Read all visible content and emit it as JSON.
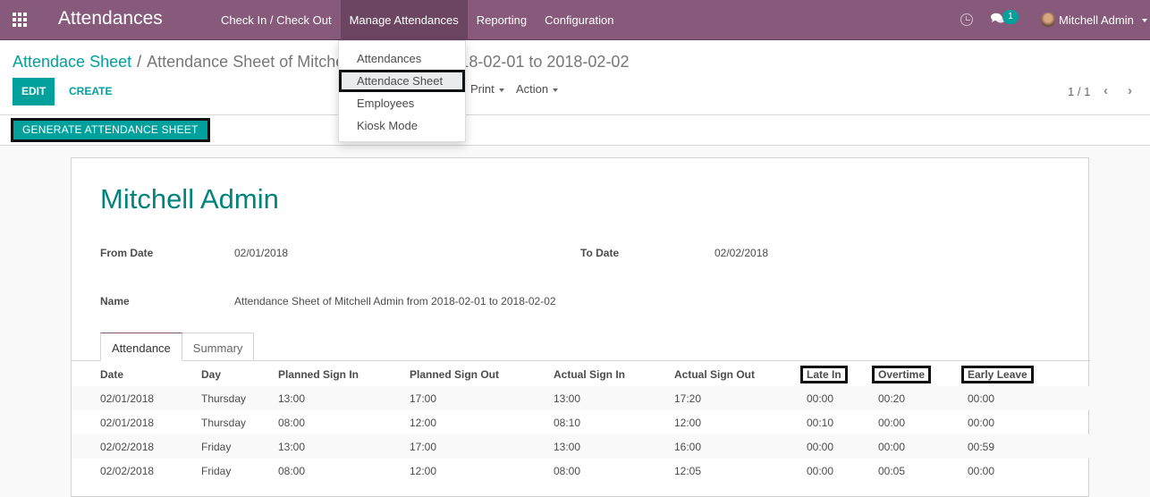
{
  "navbar": {
    "app_title": "Attendances",
    "apps_icon": "apps-grid-icon",
    "menu": [
      {
        "label": "Check In / Check Out",
        "active": false
      },
      {
        "label": "Manage Attendances",
        "active": true
      },
      {
        "label": "Reporting",
        "active": false
      },
      {
        "label": "Configuration",
        "active": false
      }
    ],
    "systray": {
      "activity_icon": "clock-icon",
      "messages_icon": "chat-icon",
      "messages_count": "1",
      "user_name": "Mitchell Admin"
    }
  },
  "dropdown": {
    "items": [
      {
        "label": "Attendances",
        "active": false
      },
      {
        "label": "Attendace Sheet",
        "active": true
      },
      {
        "label": "Employees",
        "active": false
      },
      {
        "label": "Kiosk Mode",
        "active": false
      }
    ]
  },
  "control_panel": {
    "breadcrumb_parent": "Attendace Sheet",
    "breadcrumb_separator": "/",
    "breadcrumb_current": "Attendance Sheet of Mitchell Admin from 2018-02-01 to 2018-02-02",
    "edit_label": "EDIT",
    "create_label": "CREATE",
    "print_label": "Print",
    "action_label": "Action",
    "pager_value": "1 / 1",
    "pager_prev": "‹",
    "pager_next": "›",
    "generate_label": "GENERATE ATTENDANCE SHEET"
  },
  "sheet": {
    "employee_name": "Mitchell Admin",
    "from_date_label": "From Date",
    "from_date_value": "02/01/2018",
    "to_date_label": "To Date",
    "to_date_value": "02/02/2018",
    "name_label": "Name",
    "name_value": "Attendance Sheet of Mitchell Admin from 2018-02-01 to 2018-02-02",
    "tabs": [
      {
        "label": "Attendance",
        "active": true
      },
      {
        "label": "Summary",
        "active": false
      }
    ],
    "table": {
      "columns": [
        "Date",
        "Day",
        "Planned Sign In",
        "Planned Sign Out",
        "Actual Sign In",
        "Actual Sign Out",
        "Late In",
        "Overtime",
        "Early Leave"
      ],
      "rows": [
        [
          "02/01/2018",
          "Thursday",
          "13:00",
          "17:00",
          "13:00",
          "17:20",
          "00:00",
          "00:20",
          "00:00"
        ],
        [
          "02/01/2018",
          "Thursday",
          "08:00",
          "12:00",
          "08:10",
          "12:00",
          "00:10",
          "00:00",
          "00:00"
        ],
        [
          "02/02/2018",
          "Friday",
          "13:00",
          "17:00",
          "13:00",
          "16:00",
          "00:00",
          "00:00",
          "00:59"
        ],
        [
          "02/02/2018",
          "Friday",
          "08:00",
          "12:00",
          "08:00",
          "12:05",
          "00:00",
          "00:05",
          "00:00"
        ]
      ]
    }
  }
}
